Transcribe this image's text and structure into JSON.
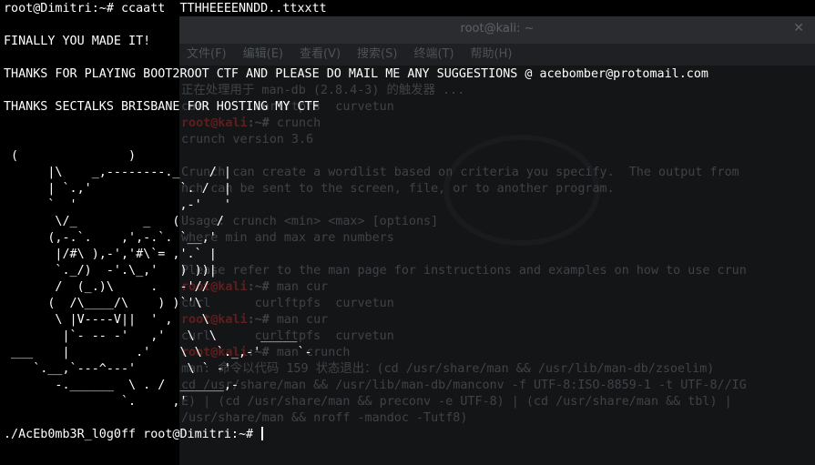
{
  "background_window": {
    "title": "root@kali: ~",
    "close_glyph": "✕",
    "menu": [
      "文件(F)",
      "编辑(E)",
      "查看(V)",
      "搜索(S)",
      "终端(T)",
      "帮助(H)"
    ],
    "lines": [
      {
        "text": "正在处理用于 man-db (2.8.4-3) 的触发器 ..."
      },
      {
        "text": "curl      curlftpfs  curvetun"
      },
      {
        "user": "root@kali",
        "sep": ":~# ",
        "text": "crunch"
      },
      {
        "text": "crunch version 3.6"
      },
      {
        "text": ""
      },
      {
        "text": "Crunch can create a wordlist based on criteria you specify.  The output from"
      },
      {
        "text": "nch can be sent to the screen, file, or to another program."
      },
      {
        "text": ""
      },
      {
        "text": "Usage: crunch <min> <max> [options]"
      },
      {
        "text": "where min and max are numbers"
      },
      {
        "text": ""
      },
      {
        "text": "Please refer to the man page for instructions and examples on how to use crun"
      },
      {
        "user": "root@kali",
        "sep": ":~# ",
        "text": "man cur"
      },
      {
        "text": "curl      curlftpfs  curvetun"
      },
      {
        "user": "root@kali",
        "sep": ":~# ",
        "text": "man cur"
      },
      {
        "text": "curl      curlftpfs  curvetun"
      },
      {
        "user": "root@kali",
        "sep": ":~# ",
        "text": "man crunch"
      },
      {
        "text": "man: 命令以代码 159 状态退出：(cd /usr/share/man && /usr/lib/man-db/zsoelim)"
      },
      {
        "text": "cd /usr/share/man && /usr/lib/man-db/manconv -f UTF-8:ISO-8859-1 -t UTF-8//IG"
      },
      {
        "text": "E) | (cd /usr/share/man && preconv -e UTF-8) | (cd /usr/share/man && tbl) |"
      },
      {
        "text": "/usr/share/man && nroff -mandoc -Tutf8)"
      }
    ]
  },
  "terminal": {
    "lines": [
      "root@Dimitri:~# ccaatt  TTHHEEEENNDD..ttxxtt",
      "",
      "FINALLY YOU MADE IT!",
      "",
      "THANKS FOR PLAYING BOOT2ROOT CTF AND PLEASE DO MAIL ME ANY SUGGESTIONS @ acebomber@protomail.com",
      "",
      "THANKS SECTALKS BRISBANE FOR HOSTING MY CTF",
      "",
      "",
      " (               )",
      "      |\\    _,--------._    / |",
      "      | `.,'            `. /  |",
      "      `  '              ,-'   '",
      "       \\/_         _   (     /",
      "      (,-.`.    ,',-.`. `__,'",
      "       |/#\\ ),-','#\\`= ,'.` |",
      "       `._/)  -'.\\_,'   ) ))|",
      "       /  (_.)\\     .   -'//",
      "      (  /\\____/\\    ) )`'\\",
      "       \\ |V----V||  ' ,    \\",
      "        |`- -- -'   ,'   \\  \\      _____",
      " ___    |         .'    \\ \\  `._,-'     `-",
      "    `.__,`---^---'       \\ ` -'",
      "       -.______  \\ . /  ______,-",
      "                `.     ,'",
      "",
      "./AcEb0mb3R_l0g0ff root@Dimitri:~# "
    ]
  }
}
